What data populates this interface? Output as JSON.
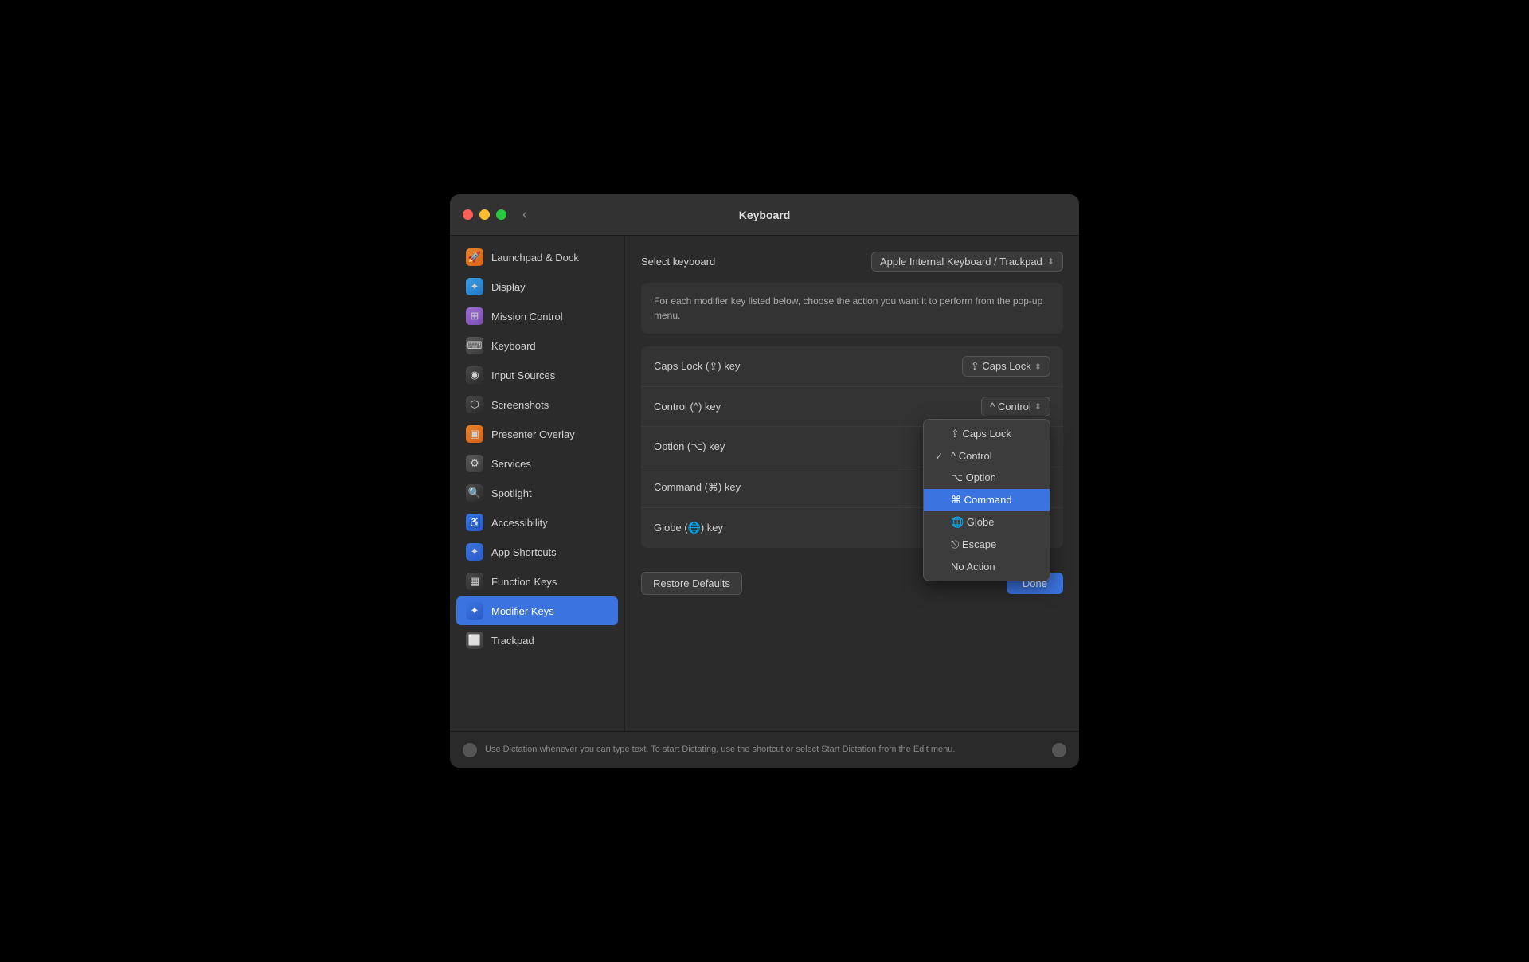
{
  "window": {
    "title": "Keyboard",
    "traffic_lights": {
      "close": "close",
      "minimize": "minimize",
      "maximize": "maximize"
    }
  },
  "sidebar": {
    "items": [
      {
        "id": "launchpad",
        "label": "Launchpad & Dock",
        "icon": "🚀",
        "icon_class": "icon-orange"
      },
      {
        "id": "display",
        "label": "Display",
        "icon": "✦",
        "icon_class": "icon-blue-light"
      },
      {
        "id": "mission-control",
        "label": "Mission Control",
        "icon": "⊞",
        "icon_class": "icon-purple"
      },
      {
        "id": "keyboard",
        "label": "Keyboard",
        "icon": "⌨",
        "icon_class": "icon-gray"
      },
      {
        "id": "input-sources",
        "label": "Input Sources",
        "icon": "◉",
        "icon_class": "icon-dark-gray"
      },
      {
        "id": "screenshots",
        "label": "Screenshots",
        "icon": "⬡",
        "icon_class": "icon-dark-gray"
      },
      {
        "id": "presenter-overlay",
        "label": "Presenter Overlay",
        "icon": "▣",
        "icon_class": "icon-orange"
      },
      {
        "id": "services",
        "label": "Services",
        "icon": "⚙",
        "icon_class": "icon-gray"
      },
      {
        "id": "spotlight",
        "label": "Spotlight",
        "icon": "🔍",
        "icon_class": "icon-dark-gray"
      },
      {
        "id": "accessibility",
        "label": "Accessibility",
        "icon": "♿",
        "icon_class": "icon-blue"
      },
      {
        "id": "app-shortcuts",
        "label": "App Shortcuts",
        "icon": "✦",
        "icon_class": "icon-blue"
      },
      {
        "id": "function-keys",
        "label": "Function Keys",
        "icon": "▦",
        "icon_class": "icon-dark-gray"
      },
      {
        "id": "modifier-keys",
        "label": "Modifier Keys",
        "icon": "✦",
        "icon_class": "icon-blue",
        "active": true
      }
    ]
  },
  "main": {
    "keyboard_selector": {
      "label": "Select keyboard",
      "value": "Apple Internal Keyboard / Trackpad"
    },
    "description": "For each modifier key listed below, choose the action you want it to perform from the pop-up menu.",
    "modifier_rows": [
      {
        "key": "Caps Lock (⇪) key",
        "value": "⇪ Caps Lock"
      },
      {
        "key": "Control (^) key",
        "value": "^ Control"
      },
      {
        "key": "Option (⌥) key",
        "value": "⌥ Option"
      },
      {
        "key": "Command (⌘) key",
        "value": "⌘ Command"
      },
      {
        "key": "Globe (🌐) key",
        "value": "🌐 Globe"
      }
    ],
    "popup_menu": {
      "visible": true,
      "row_index": 2,
      "items": [
        {
          "label": "⇪ Caps Lock",
          "icon": "⇪",
          "selected": false,
          "checked": false
        },
        {
          "label": "^ Control",
          "icon": "^",
          "selected": false,
          "checked": true
        },
        {
          "label": "⌥ Option",
          "icon": "⌥",
          "selected": false,
          "checked": false
        },
        {
          "label": "⌘ Command",
          "icon": "⌘",
          "selected": true,
          "checked": false
        },
        {
          "label": "🌐 Globe",
          "icon": "🌐",
          "selected": false,
          "checked": false
        },
        {
          "label": "⎋ Escape",
          "icon": "⎋",
          "selected": false,
          "checked": false
        },
        {
          "label": "No Action",
          "icon": "",
          "selected": false,
          "checked": false
        }
      ]
    },
    "footer": {
      "restore_label": "Restore Defaults",
      "done_label": "Done"
    }
  },
  "bottom_bar": {
    "dictation_text": "Use Dictation whenever you can type text. To start Dictating, use the shortcut or select Start Dictation from the Edit menu."
  },
  "trackpad_item": {
    "label": "Trackpad"
  }
}
